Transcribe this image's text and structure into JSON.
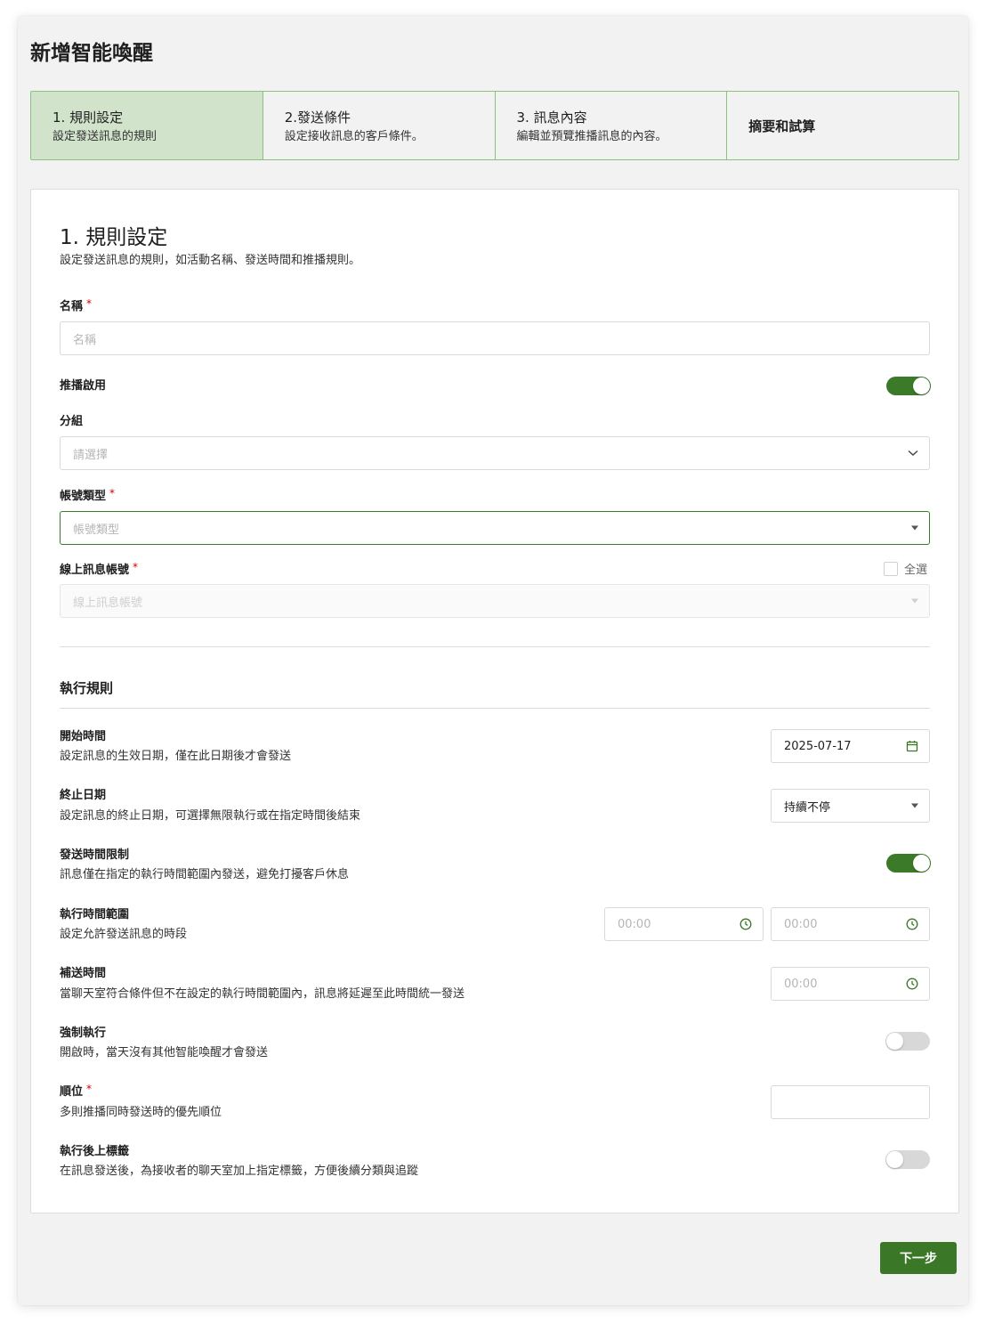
{
  "page": {
    "title": "新增智能喚醒"
  },
  "steps": [
    {
      "title": "1. 規則設定",
      "desc": "設定發送訊息的規則"
    },
    {
      "title": "2.發送條件",
      "desc": "設定接收訊息的客戶條件。"
    },
    {
      "title": "3. 訊息內容",
      "desc": "編輯並預覽推播訊息的內容。"
    },
    {
      "title": "摘要和試算",
      "desc": ""
    }
  ],
  "section": {
    "title": "1. 規則設定",
    "desc": "設定發送訊息的規則，如活動名稱、發送時間和推播規則。"
  },
  "form": {
    "name": {
      "label": "名稱",
      "required": "*",
      "placeholder": "名稱"
    },
    "push_enabled": {
      "label": "推播啟用",
      "on": true
    },
    "group": {
      "label": "分組",
      "placeholder": "請選擇"
    },
    "account_type": {
      "label": "帳號類型",
      "required": "*",
      "placeholder": "帳號類型"
    },
    "online_account": {
      "label": "線上訊息帳號",
      "required": "*",
      "placeholder": "線上訊息帳號",
      "select_all": "全選"
    }
  },
  "rules": {
    "title": "執行規則",
    "start_time": {
      "title": "開始時間",
      "desc": "設定訊息的生效日期，僅在此日期後才會發送",
      "value": "2025-07-17"
    },
    "end_date": {
      "title": "終止日期",
      "desc": "設定訊息的終止日期，可選擇無限執行或在指定時間後結束",
      "value": "持續不停"
    },
    "send_time_limit": {
      "title": "發送時間限制",
      "desc": "訊息僅在指定的執行時間範圍內發送，避免打擾客戶休息",
      "on": true
    },
    "time_range": {
      "title": "執行時間範圍",
      "desc": "設定允許發送訊息的時段",
      "start_placeholder": "00:00",
      "end_placeholder": "00:00"
    },
    "resend_time": {
      "title": "補送時間",
      "desc": "當聊天室符合條件但不在設定的執行時間範圍內，訊息將延遲至此時間統一發送",
      "placeholder": "00:00"
    },
    "force_execute": {
      "title": "強制執行",
      "desc": "開啟時，當天沒有其他智能喚醒才會發送",
      "on": false
    },
    "priority": {
      "title": "順位",
      "required": "*",
      "desc": "多則推播同時發送時的優先順位",
      "value": ""
    },
    "tag_after": {
      "title": "執行後上標籤",
      "desc": "在訊息發送後，為接收者的聊天室加上指定標籤，方便後續分類與追蹤",
      "on": false
    }
  },
  "actions": {
    "next": "下一步"
  },
  "colors": {
    "accent": "#3a7726",
    "step_active_bg": "#d2e3cc",
    "step_border": "#8cc07f",
    "required": "#cc0000"
  }
}
